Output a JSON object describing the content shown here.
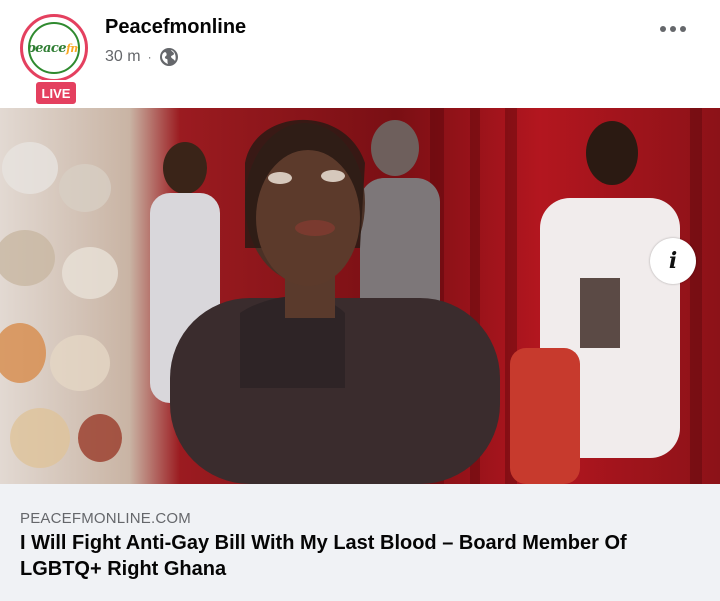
{
  "post": {
    "page_name": "Peacefmonline",
    "time": "30 m",
    "separator": "·",
    "privacy_icon": "globe-icon",
    "more_icon": "more-horizontal-icon",
    "live_badge": "LIVE",
    "logo_text_main": "peace",
    "logo_text_fm": "fm"
  },
  "media": {
    "info_label": "i",
    "info_icon": "info-icon"
  },
  "link": {
    "domain": "PEACEFMONLINE.COM",
    "title": "I Will Fight Anti-Gay Bill With My Last Blood – Board Member Of LGBTQ+ Right Ghana"
  },
  "colors": {
    "live_badge": "#e4405f",
    "secondary_text": "#65676b",
    "link_background": "#f0f2f5"
  }
}
